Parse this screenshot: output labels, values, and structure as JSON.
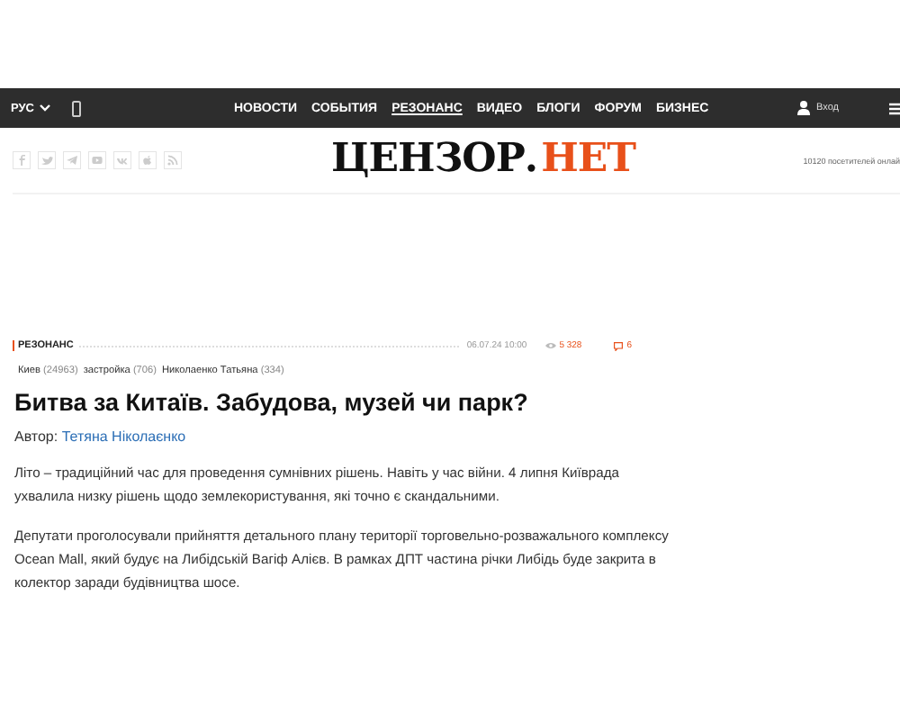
{
  "topbar": {
    "language": "РУС",
    "nav": [
      {
        "label": "НОВОСТИ",
        "selected": false
      },
      {
        "label": "СОБЫТИЯ",
        "selected": false
      },
      {
        "label": "РЕЗОНАНС",
        "selected": true
      },
      {
        "label": "ВИДЕО",
        "selected": false
      },
      {
        "label": "БЛОГИ",
        "selected": false
      },
      {
        "label": "ФОРУМ",
        "selected": false
      },
      {
        "label": "БИЗНЕС",
        "selected": false
      }
    ],
    "login": "Вход"
  },
  "header": {
    "logo_main": "ЦЕНЗОР",
    "logo_dot": ".",
    "logo_accent": "НЕТ",
    "visitors": "10120 посетителей онлай"
  },
  "article": {
    "section": "РЕЗОНАНС",
    "date": "06.07.24 10:00",
    "views": "5 328",
    "comments": "6",
    "tags": [
      {
        "name": "Киев",
        "count": "(24963)"
      },
      {
        "name": "застройка",
        "count": "(706)"
      },
      {
        "name": "Николаенко Татьяна",
        "count": "(334)"
      }
    ],
    "title": "Битва за Китаїв. Забудова, музей чи парк?",
    "author_label": "Автор:",
    "author": "Тетяна Ніколаєнко",
    "paragraphs": [
      "Літо – традиційний час для проведення сумнівних рішень. Навіть у час війни. 4 липня Київрада ухвалила низку рішень щодо землекористування, які точно є скандальними.",
      "Депутати проголосували прийняття детального плану території торговельно-розважального комплексу Ocean Mall, який будує на Либідській Вагіф Алієв. В рамках ДПТ частина річки Либідь буде закрита в колектор заради будівництва шосе."
    ]
  }
}
